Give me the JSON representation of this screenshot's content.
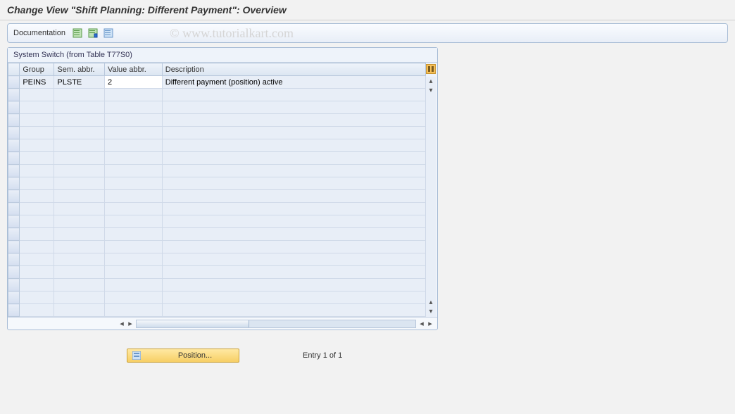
{
  "title": "Change View \"Shift Planning: Different Payment\": Overview",
  "toolbar": {
    "documentation_label": "Documentation"
  },
  "watermark": "© www.tutorialkart.com",
  "panel": {
    "title": "System Switch (from Table T77S0)"
  },
  "columns": {
    "group": "Group",
    "sem_abbr": "Sem. abbr.",
    "value_abbr": "Value abbr.",
    "description": "Description"
  },
  "rows": [
    {
      "group": "PEINS",
      "sem_abbr": "PLSTE",
      "value_abbr": "2",
      "description": "Different payment (position) active"
    }
  ],
  "footer": {
    "position_label": "Position...",
    "entry_text": "Entry 1 of 1"
  }
}
